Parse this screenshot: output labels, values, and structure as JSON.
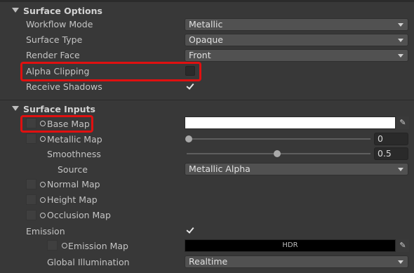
{
  "surface_options": {
    "title": "Surface Options",
    "workflow_mode": {
      "label": "Workflow Mode",
      "value": "Metallic"
    },
    "surface_type": {
      "label": "Surface Type",
      "value": "Opaque"
    },
    "render_face": {
      "label": "Render Face",
      "value": "Front"
    },
    "alpha_clipping": {
      "label": "Alpha Clipping",
      "checked": false
    },
    "receive_shadows": {
      "label": "Receive Shadows",
      "checked": true
    }
  },
  "surface_inputs": {
    "title": "Surface Inputs",
    "base_map": {
      "label": "Base Map",
      "color": "#ffffff"
    },
    "metallic_map": {
      "label": "Metallic Map",
      "value": "0",
      "fraction": 0.0
    },
    "smoothness": {
      "label": "Smoothness",
      "value": "0.5",
      "fraction": 0.5
    },
    "source": {
      "label": "Source",
      "value": "Metallic Alpha"
    },
    "normal_map": {
      "label": "Normal Map"
    },
    "height_map": {
      "label": "Height Map"
    },
    "occlusion_map": {
      "label": "Occlusion Map"
    },
    "emission": {
      "label": "Emission",
      "checked": true
    },
    "emission_map": {
      "label": "Emission Map",
      "color_badge": "HDR",
      "color": "#000000"
    },
    "global_illumination": {
      "label": "Global Illumination",
      "value": "Realtime"
    }
  },
  "colors": {
    "highlight": "#e01010",
    "panel": "#383838"
  }
}
